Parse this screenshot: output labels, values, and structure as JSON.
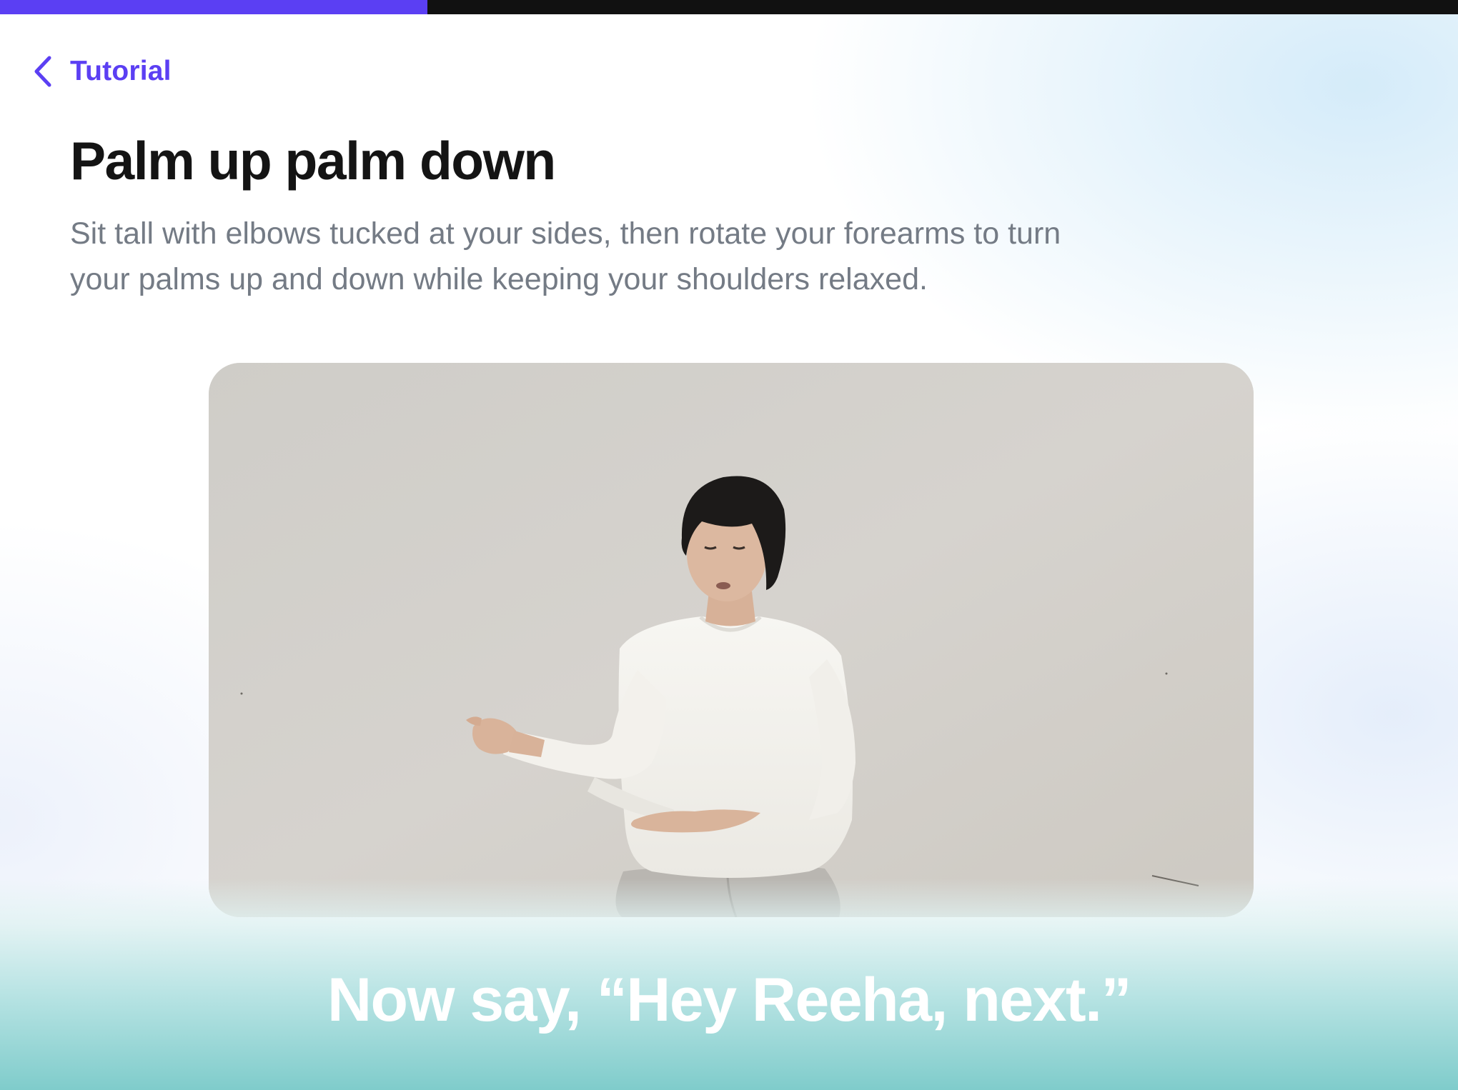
{
  "progress": {
    "fraction": 0.293,
    "fill_color": "#5b3ff3",
    "track_color": "#111111"
  },
  "nav": {
    "back_icon": "chevron-left-icon",
    "back_label": "Tutorial",
    "accent_color": "#5b3ff3"
  },
  "exercise": {
    "title": "Palm up palm down",
    "description": "Sit tall with elbows tucked at your sides, then rotate your forearms to turn your palms up and down while keeping your shoulders relaxed."
  },
  "video": {
    "icon": "exercise-demo-video"
  },
  "voice_prompt": {
    "text": "Now say, “Hey Reeha, next.”"
  }
}
